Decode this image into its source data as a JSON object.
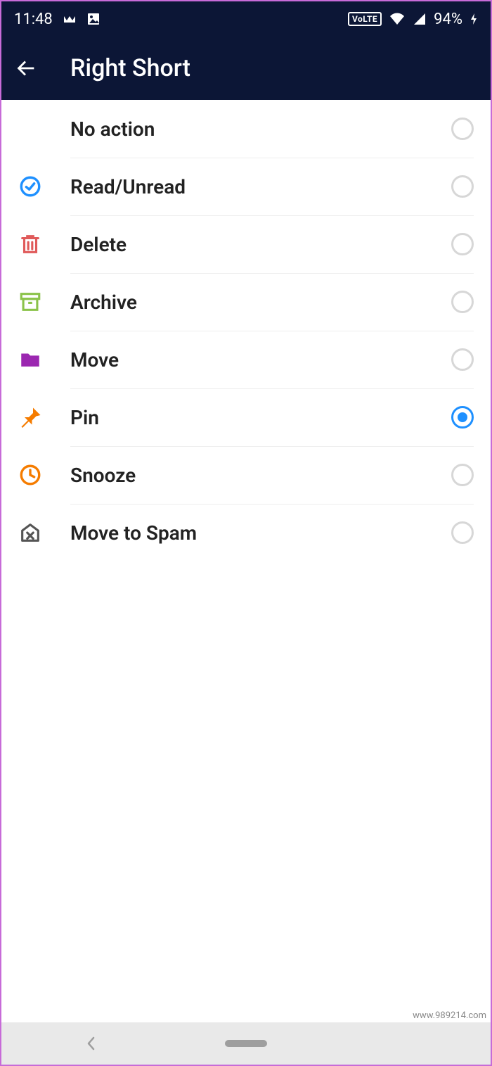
{
  "statusbar": {
    "time": "11:48",
    "volte": "VoLTE",
    "battery": "94%"
  },
  "appbar": {
    "title": "Right Short"
  },
  "options": [
    {
      "id": "no-action",
      "label": "No action",
      "icon": "",
      "selected": false
    },
    {
      "id": "read-unread",
      "label": "Read/Unread",
      "icon": "check-circle",
      "color": "#1e90ff",
      "selected": false
    },
    {
      "id": "delete",
      "label": "Delete",
      "icon": "trash",
      "color": "#e05a5a",
      "selected": false
    },
    {
      "id": "archive",
      "label": "Archive",
      "icon": "archive",
      "color": "#8bc34a",
      "selected": false
    },
    {
      "id": "move",
      "label": "Move",
      "icon": "folder",
      "color": "#9b27b0",
      "selected": false
    },
    {
      "id": "pin",
      "label": "Pin",
      "icon": "pin",
      "color": "#f57c00",
      "selected": true
    },
    {
      "id": "snooze",
      "label": "Snooze",
      "icon": "clock",
      "color": "#f57c00",
      "selected": false
    },
    {
      "id": "spam",
      "label": "Move to Spam",
      "icon": "spam",
      "color": "#555",
      "selected": false
    }
  ],
  "watermark": "www.989214.com"
}
